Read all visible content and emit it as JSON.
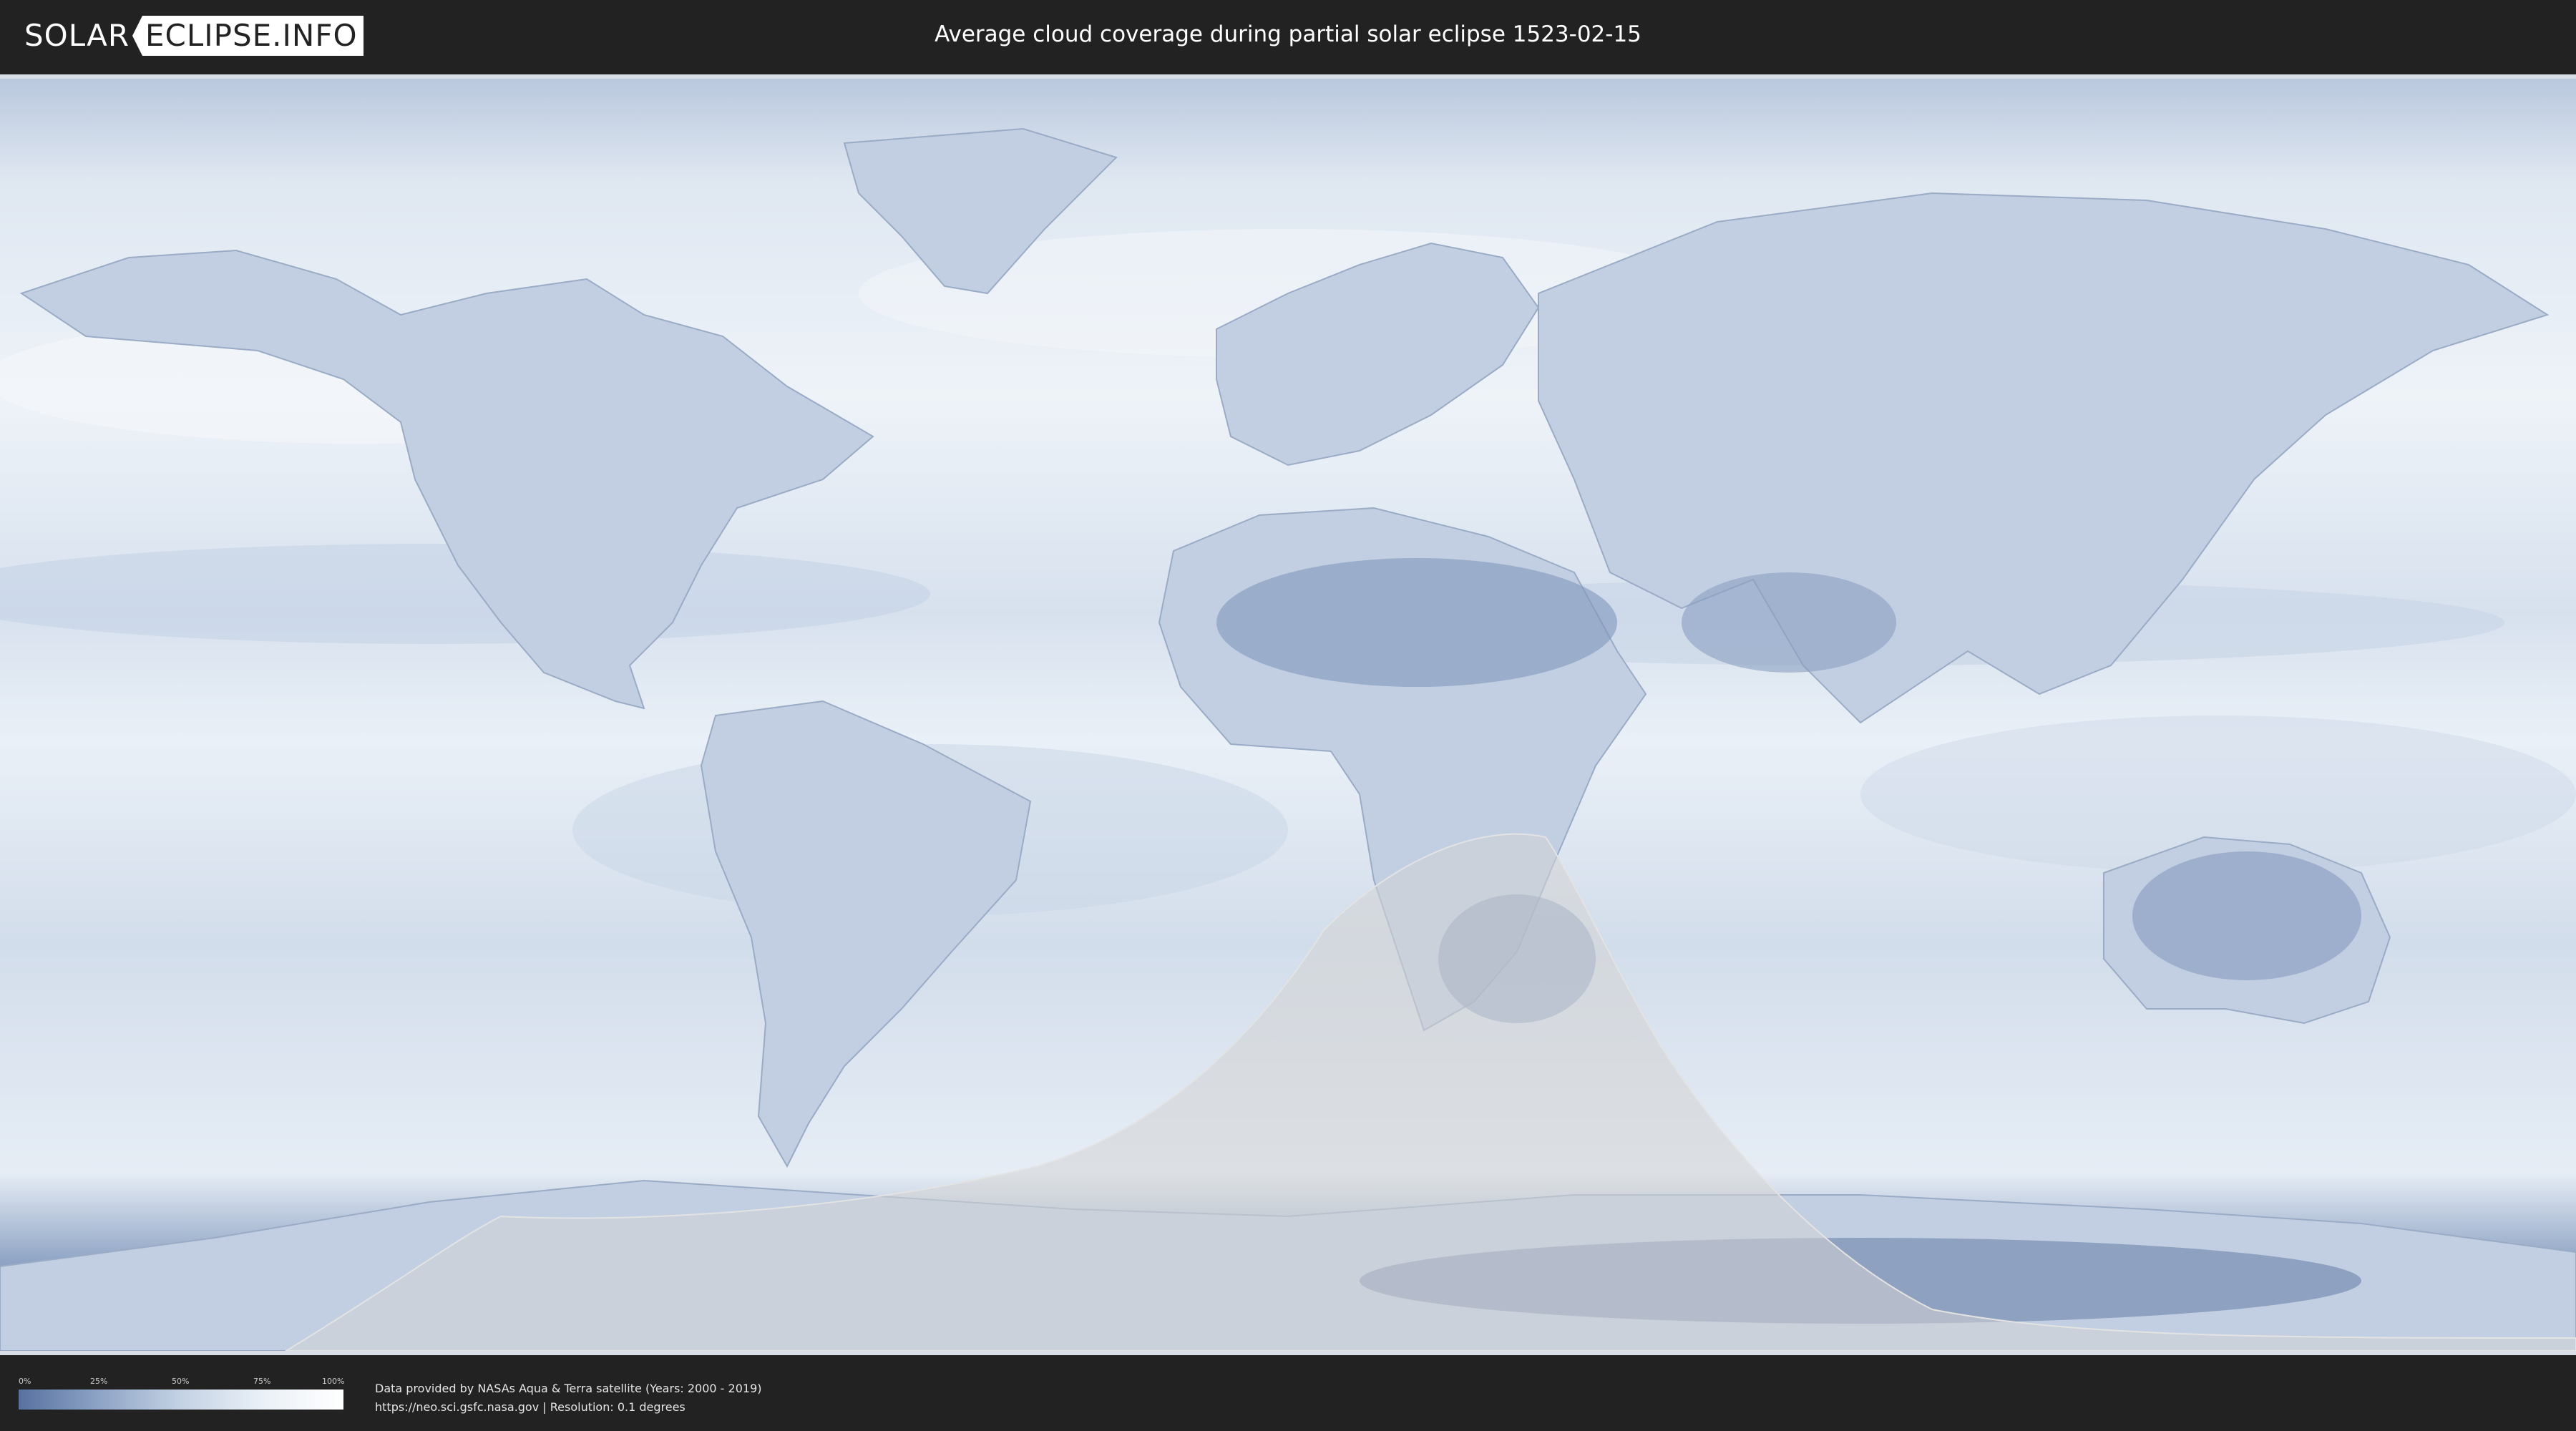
{
  "header": {
    "logo_left": "SOLAR",
    "logo_right": "ECLIPSE.INFO",
    "title": "Average cloud coverage during partial solar eclipse 1523-02-15"
  },
  "map": {
    "base_color": "#e9eef5",
    "cloud_low_color": "#5872a0",
    "cloud_high_color": "#ffffff",
    "eclipse_shadow_color": "#d4d4d4"
  },
  "legend": {
    "ticks": [
      "0%",
      "25%",
      "50%",
      "75%",
      "100%"
    ]
  },
  "credits": {
    "line1": "Data provided by NASAs Aqua & Terra satellite (Years: 2000 - 2019)",
    "line2": "https://neo.sci.gsfc.nasa.gov | Resolution: 0.1 degrees"
  }
}
